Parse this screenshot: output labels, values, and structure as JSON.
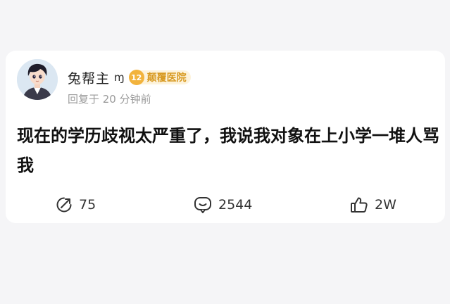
{
  "post": {
    "username": "兔帮主",
    "username_suffix": "ɱ",
    "badge": {
      "level": "12",
      "name": "颠覆医院",
      "color": "#f2b33d"
    },
    "meta": "回复于 20 分钟前",
    "content": "现在的学历歧视太严重了，我说我对象在上小学一堆人骂我"
  },
  "actions": {
    "share": {
      "icon": "share-icon",
      "count": "75"
    },
    "comment": {
      "icon": "comment-icon",
      "count": "2544"
    },
    "like": {
      "icon": "thumbs-up-icon",
      "count": "2W"
    }
  }
}
